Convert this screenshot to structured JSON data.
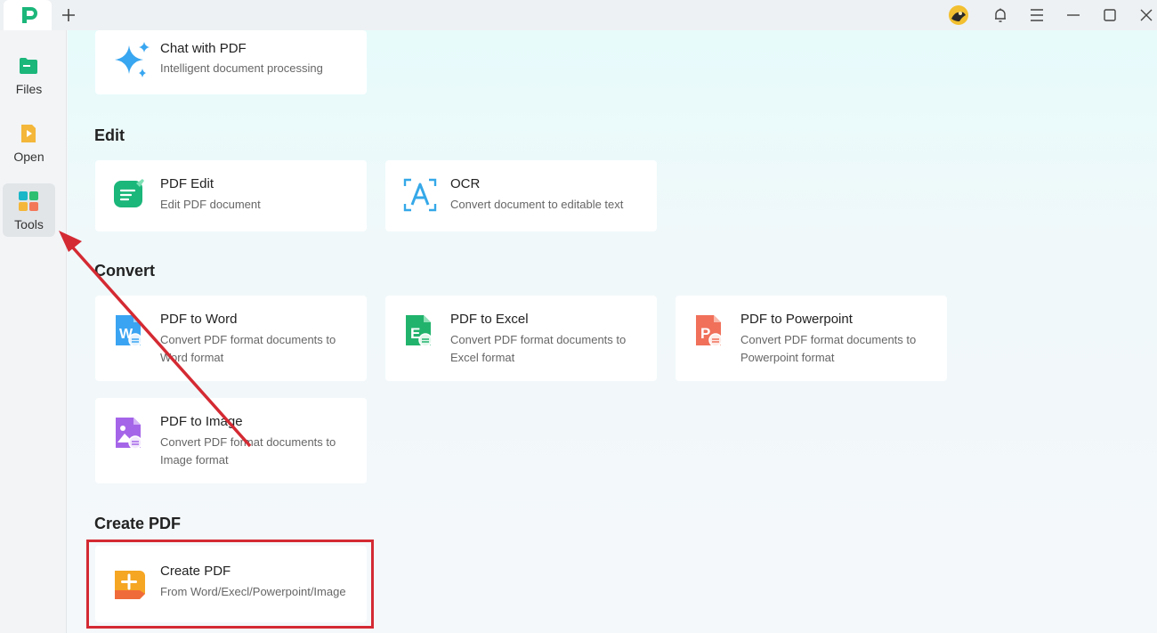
{
  "titlebar": {
    "logo_icon": "app-logo-icon",
    "new_tab_label": "+",
    "controls": [
      "avatar",
      "bell-icon",
      "menu-icon",
      "minimize-icon",
      "maximize-icon",
      "close-icon"
    ]
  },
  "sidebar": {
    "items": [
      {
        "label": "Files",
        "icon": "files-icon"
      },
      {
        "label": "Open",
        "icon": "open-icon"
      },
      {
        "label": "Tools",
        "icon": "tools-icon",
        "active": true
      }
    ]
  },
  "sections": {
    "edit": "Edit",
    "convert": "Convert",
    "create": "Create PDF"
  },
  "cards": {
    "chat": {
      "title": "Chat with PDF",
      "desc": "Intelligent document processing"
    },
    "pdf_edit": {
      "title": "PDF Edit",
      "desc": "Edit PDF document"
    },
    "ocr": {
      "title": "OCR",
      "desc": "Convert document to editable text"
    },
    "to_word": {
      "title": "PDF to Word",
      "desc": "Convert PDF format documents to Word format"
    },
    "to_excel": {
      "title": "PDF to Excel",
      "desc": "Convert PDF format documents to Excel format"
    },
    "to_ppt": {
      "title": "PDF to Powerpoint",
      "desc": "Convert PDF format documents to Powerpoint format"
    },
    "to_image": {
      "title": "PDF to Image",
      "desc": "Convert PDF format documents to Image format"
    },
    "create_pdf": {
      "title": "Create PDF",
      "desc": "From Word/Execl/Powerpoint/Image"
    }
  },
  "colors": {
    "accent_green": "#1bb67a",
    "highlight_red": "#d42a33",
    "arrow_red": "#d42a33"
  }
}
